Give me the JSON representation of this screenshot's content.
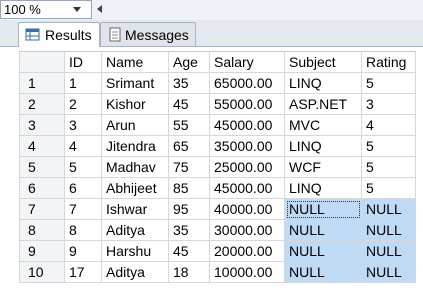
{
  "toolbar": {
    "zoom_value": "100 %"
  },
  "tabs": [
    {
      "label": "Results",
      "icon": "grid-icon",
      "active": true
    },
    {
      "label": "Messages",
      "icon": "document-icon",
      "active": false
    }
  ],
  "grid": {
    "columns": [
      "ID",
      "Name",
      "Age",
      "Salary",
      "Subject",
      "Rating"
    ],
    "rows": [
      {
        "row_num": "1",
        "cells": [
          "1",
          "Srimant",
          "35",
          "65000.00",
          "LINQ",
          "5"
        ]
      },
      {
        "row_num": "2",
        "cells": [
          "2",
          "Kishor",
          "45",
          "55000.00",
          "ASP.NET",
          "3"
        ]
      },
      {
        "row_num": "3",
        "cells": [
          "3",
          "Arun",
          "55",
          "45000.00",
          "MVC",
          "4"
        ]
      },
      {
        "row_num": "4",
        "cells": [
          "4",
          "Jitendra",
          "65",
          "35000.00",
          "LINQ",
          "5"
        ]
      },
      {
        "row_num": "5",
        "cells": [
          "5",
          "Madhav",
          "75",
          "25000.00",
          "WCF",
          "5"
        ]
      },
      {
        "row_num": "6",
        "cells": [
          "6",
          "Abhijeet",
          "85",
          "45000.00",
          "LINQ",
          "5"
        ]
      },
      {
        "row_num": "7",
        "cells": [
          "7",
          "Ishwar",
          "95",
          "40000.00",
          "NULL",
          "NULL"
        ]
      },
      {
        "row_num": "8",
        "cells": [
          "8",
          "Aditya",
          "35",
          "30000.00",
          "NULL",
          "NULL"
        ]
      },
      {
        "row_num": "9",
        "cells": [
          "9",
          "Harshu",
          "45",
          "20000.00",
          "NULL",
          "NULL"
        ]
      },
      {
        "row_num": "10",
        "cells": [
          "17",
          "Aditya",
          "18",
          "10000.00",
          "NULL",
          "NULL"
        ]
      }
    ],
    "null_highlight_color": "#bedaf5"
  }
}
